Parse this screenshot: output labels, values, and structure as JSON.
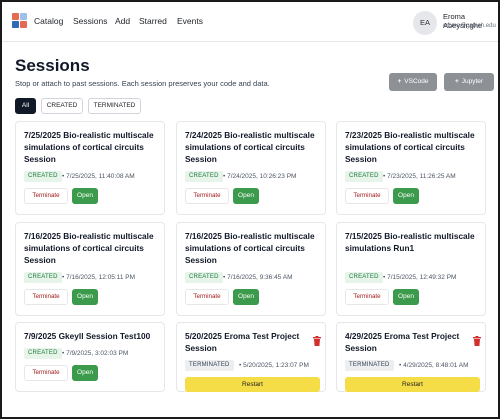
{
  "nav": {
    "links": [
      "Catalog",
      "Sessions",
      "Add",
      "Starred",
      "Events"
    ],
    "avatar_initials": "EA",
    "user_name": "Eroma Abeysinghe",
    "user_email": "eroma@gatech.edu",
    "logo_colors": [
      "#e46a52",
      "#a0c0e8",
      "#2f6bb5",
      "#e46a52"
    ]
  },
  "page": {
    "title": "Sessions",
    "subtitle": "Stop or attach to past sessions. Each session preserves your code and data.",
    "vscode_label": "VSCode",
    "jupyter_label": "Jupyter",
    "plus_glyph": "+"
  },
  "tabs": [
    "All",
    "CREATED",
    "TERMINATED"
  ],
  "actions": {
    "terminate": "Terminate",
    "open": "Open",
    "restart": "Restart"
  },
  "sessions": [
    {
      "title": "7/25/2025 Bio-realistic multiscale simulations of cortical circuits Session",
      "status": "CREATED",
      "time": "• 7/25/2025, 11:40:08 AM"
    },
    {
      "title": "7/24/2025 Bio-realistic multiscale simulations of cortical circuits Session",
      "status": "CREATED",
      "time": "• 7/24/2025, 10:26:23 PM"
    },
    {
      "title": "7/23/2025 Bio-realistic multiscale simulations of cortical circuits Session",
      "status": "CREATED",
      "time": "• 7/23/2025, 11:26:25 AM"
    },
    {
      "title": "7/16/2025 Bio-realistic multiscale simulations of cortical circuits Session",
      "status": "CREATED",
      "time": "• 7/16/2025, 12:05:11 PM"
    },
    {
      "title": "7/16/2025 Bio-realistic multiscale simulations of cortical circuits Session",
      "status": "CREATED",
      "time": "• 7/16/2025, 9:36:45 AM"
    },
    {
      "title": "7/15/2025 Bio-realistic multiscale simulations Run1",
      "status": "CREATED",
      "time": "• 7/15/2025, 12:49:32 PM"
    },
    {
      "title": "7/9/2025 Gkeyll Session Test100",
      "status": "CREATED",
      "time": "• 7/9/2025, 3:02:03 PM"
    },
    {
      "title": "5/20/2025 Eroma Test Project Session",
      "status": "TERMINATED",
      "time": "• 5/20/2025, 1:23:07 PM"
    },
    {
      "title": "4/29/2025 Eroma Test Project Session",
      "status": "TERMINATED",
      "time": "• 4/29/2025, 8:48:01 AM"
    }
  ]
}
